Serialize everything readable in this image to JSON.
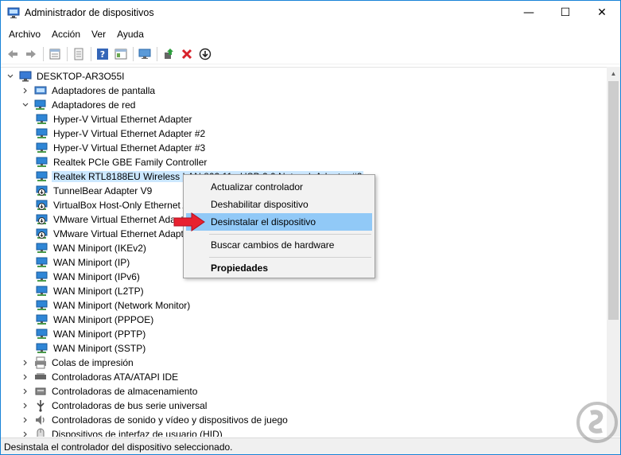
{
  "window": {
    "title": "Administrador de dispositivos",
    "minimize": "—",
    "maximize": "☐",
    "close": "✕"
  },
  "menu": [
    "Archivo",
    "Acción",
    "Ver",
    "Ayuda"
  ],
  "toolbar": {
    "icons": [
      "back-icon",
      "forward-icon",
      "properties-icon",
      "device-list-icon",
      "help-icon",
      "view-icon",
      "monitor-icon",
      "update-driver-icon",
      "uninstall-icon",
      "download-icon"
    ]
  },
  "tree": {
    "root": "DESKTOP-AR3O55I",
    "items": [
      {
        "label": "Adaptadores de pantalla",
        "level": 1,
        "expander": "collapsed",
        "icon": "display"
      },
      {
        "label": "Adaptadores de red",
        "level": 1,
        "expander": "expanded",
        "icon": "network"
      },
      {
        "label": "Hyper-V Virtual Ethernet Adapter",
        "level": 2,
        "icon": "network"
      },
      {
        "label": "Hyper-V Virtual Ethernet Adapter #2",
        "level": 2,
        "icon": "network"
      },
      {
        "label": "Hyper-V Virtual Ethernet Adapter #3",
        "level": 2,
        "icon": "network"
      },
      {
        "label": "Realtek PCIe GBE Family Controller",
        "level": 2,
        "icon": "network"
      },
      {
        "label": "Realtek RTL8188EU Wireless LAN 802.11n USB 2.0 Network Adapter #2",
        "level": 2,
        "icon": "network",
        "selected": true
      },
      {
        "label": "TunnelBear Adapter V9",
        "level": 2,
        "icon": "network-down"
      },
      {
        "label": "VirtualBox Host-Only Ethernet Adapter",
        "level": 2,
        "icon": "network-down"
      },
      {
        "label": "VMware Virtual Ethernet Adapter for VMnet1",
        "level": 2,
        "icon": "network-down"
      },
      {
        "label": "VMware Virtual Ethernet Adapter for VMnet8",
        "level": 2,
        "icon": "network-down"
      },
      {
        "label": "WAN Miniport (IKEv2)",
        "level": 2,
        "icon": "network"
      },
      {
        "label": "WAN Miniport (IP)",
        "level": 2,
        "icon": "network"
      },
      {
        "label": "WAN Miniport (IPv6)",
        "level": 2,
        "icon": "network"
      },
      {
        "label": "WAN Miniport (L2TP)",
        "level": 2,
        "icon": "network"
      },
      {
        "label": "WAN Miniport (Network Monitor)",
        "level": 2,
        "icon": "network"
      },
      {
        "label": "WAN Miniport (PPPOE)",
        "level": 2,
        "icon": "network"
      },
      {
        "label": "WAN Miniport (PPTP)",
        "level": 2,
        "icon": "network"
      },
      {
        "label": "WAN Miniport (SSTP)",
        "level": 2,
        "icon": "network"
      },
      {
        "label": "Colas de impresión",
        "level": 1,
        "expander": "collapsed",
        "icon": "printer"
      },
      {
        "label": "Controladoras ATA/ATAPI IDE",
        "level": 1,
        "expander": "collapsed",
        "icon": "ide"
      },
      {
        "label": "Controladoras de almacenamiento",
        "level": 1,
        "expander": "collapsed",
        "icon": "storage"
      },
      {
        "label": "Controladoras de bus serie universal",
        "level": 1,
        "expander": "collapsed",
        "icon": "usb"
      },
      {
        "label": "Controladoras de sonido y vídeo y dispositivos de juego",
        "level": 1,
        "expander": "collapsed",
        "icon": "sound"
      },
      {
        "label": "Dispositivos de interfaz de usuario (HID)",
        "level": 1,
        "expander": "collapsed",
        "icon": "hid"
      }
    ]
  },
  "context_menu": {
    "items": [
      {
        "label": "Actualizar controlador"
      },
      {
        "label": "Deshabilitar dispositivo"
      },
      {
        "label": "Desinstalar el dispositivo",
        "highlighted": true
      },
      {
        "label": "Buscar cambios de hardware"
      },
      {
        "label": "Propiedades",
        "bold": true
      }
    ]
  },
  "status": "Desinstala el controlador del dispositivo seleccionado.",
  "colors": {
    "selection": "#cce8ff",
    "menu_highlight": "#91c9f7",
    "arrow": "#e8212f",
    "network_icon": "#2f86d6"
  }
}
